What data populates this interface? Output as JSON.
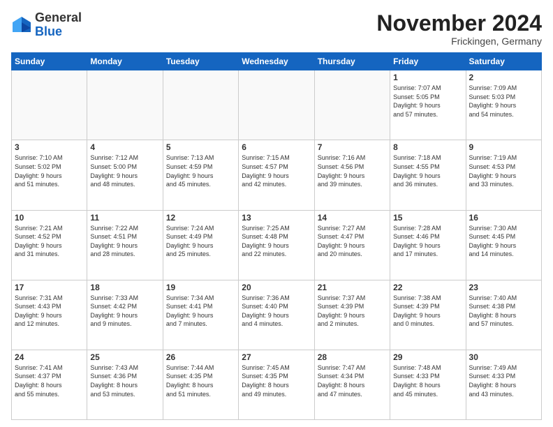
{
  "logo": {
    "general": "General",
    "blue": "Blue"
  },
  "header": {
    "month": "November 2024",
    "location": "Frickingen, Germany"
  },
  "weekdays": [
    "Sunday",
    "Monday",
    "Tuesday",
    "Wednesday",
    "Thursday",
    "Friday",
    "Saturday"
  ],
  "weeks": [
    [
      {
        "day": "",
        "info": ""
      },
      {
        "day": "",
        "info": ""
      },
      {
        "day": "",
        "info": ""
      },
      {
        "day": "",
        "info": ""
      },
      {
        "day": "",
        "info": ""
      },
      {
        "day": "1",
        "info": "Sunrise: 7:07 AM\nSunset: 5:05 PM\nDaylight: 9 hours\nand 57 minutes."
      },
      {
        "day": "2",
        "info": "Sunrise: 7:09 AM\nSunset: 5:03 PM\nDaylight: 9 hours\nand 54 minutes."
      }
    ],
    [
      {
        "day": "3",
        "info": "Sunrise: 7:10 AM\nSunset: 5:02 PM\nDaylight: 9 hours\nand 51 minutes."
      },
      {
        "day": "4",
        "info": "Sunrise: 7:12 AM\nSunset: 5:00 PM\nDaylight: 9 hours\nand 48 minutes."
      },
      {
        "day": "5",
        "info": "Sunrise: 7:13 AM\nSunset: 4:59 PM\nDaylight: 9 hours\nand 45 minutes."
      },
      {
        "day": "6",
        "info": "Sunrise: 7:15 AM\nSunset: 4:57 PM\nDaylight: 9 hours\nand 42 minutes."
      },
      {
        "day": "7",
        "info": "Sunrise: 7:16 AM\nSunset: 4:56 PM\nDaylight: 9 hours\nand 39 minutes."
      },
      {
        "day": "8",
        "info": "Sunrise: 7:18 AM\nSunset: 4:55 PM\nDaylight: 9 hours\nand 36 minutes."
      },
      {
        "day": "9",
        "info": "Sunrise: 7:19 AM\nSunset: 4:53 PM\nDaylight: 9 hours\nand 33 minutes."
      }
    ],
    [
      {
        "day": "10",
        "info": "Sunrise: 7:21 AM\nSunset: 4:52 PM\nDaylight: 9 hours\nand 31 minutes."
      },
      {
        "day": "11",
        "info": "Sunrise: 7:22 AM\nSunset: 4:51 PM\nDaylight: 9 hours\nand 28 minutes."
      },
      {
        "day": "12",
        "info": "Sunrise: 7:24 AM\nSunset: 4:49 PM\nDaylight: 9 hours\nand 25 minutes."
      },
      {
        "day": "13",
        "info": "Sunrise: 7:25 AM\nSunset: 4:48 PM\nDaylight: 9 hours\nand 22 minutes."
      },
      {
        "day": "14",
        "info": "Sunrise: 7:27 AM\nSunset: 4:47 PM\nDaylight: 9 hours\nand 20 minutes."
      },
      {
        "day": "15",
        "info": "Sunrise: 7:28 AM\nSunset: 4:46 PM\nDaylight: 9 hours\nand 17 minutes."
      },
      {
        "day": "16",
        "info": "Sunrise: 7:30 AM\nSunset: 4:45 PM\nDaylight: 9 hours\nand 14 minutes."
      }
    ],
    [
      {
        "day": "17",
        "info": "Sunrise: 7:31 AM\nSunset: 4:43 PM\nDaylight: 9 hours\nand 12 minutes."
      },
      {
        "day": "18",
        "info": "Sunrise: 7:33 AM\nSunset: 4:42 PM\nDaylight: 9 hours\nand 9 minutes."
      },
      {
        "day": "19",
        "info": "Sunrise: 7:34 AM\nSunset: 4:41 PM\nDaylight: 9 hours\nand 7 minutes."
      },
      {
        "day": "20",
        "info": "Sunrise: 7:36 AM\nSunset: 4:40 PM\nDaylight: 9 hours\nand 4 minutes."
      },
      {
        "day": "21",
        "info": "Sunrise: 7:37 AM\nSunset: 4:39 PM\nDaylight: 9 hours\nand 2 minutes."
      },
      {
        "day": "22",
        "info": "Sunrise: 7:38 AM\nSunset: 4:39 PM\nDaylight: 9 hours\nand 0 minutes."
      },
      {
        "day": "23",
        "info": "Sunrise: 7:40 AM\nSunset: 4:38 PM\nDaylight: 8 hours\nand 57 minutes."
      }
    ],
    [
      {
        "day": "24",
        "info": "Sunrise: 7:41 AM\nSunset: 4:37 PM\nDaylight: 8 hours\nand 55 minutes."
      },
      {
        "day": "25",
        "info": "Sunrise: 7:43 AM\nSunset: 4:36 PM\nDaylight: 8 hours\nand 53 minutes."
      },
      {
        "day": "26",
        "info": "Sunrise: 7:44 AM\nSunset: 4:35 PM\nDaylight: 8 hours\nand 51 minutes."
      },
      {
        "day": "27",
        "info": "Sunrise: 7:45 AM\nSunset: 4:35 PM\nDaylight: 8 hours\nand 49 minutes."
      },
      {
        "day": "28",
        "info": "Sunrise: 7:47 AM\nSunset: 4:34 PM\nDaylight: 8 hours\nand 47 minutes."
      },
      {
        "day": "29",
        "info": "Sunrise: 7:48 AM\nSunset: 4:33 PM\nDaylight: 8 hours\nand 45 minutes."
      },
      {
        "day": "30",
        "info": "Sunrise: 7:49 AM\nSunset: 4:33 PM\nDaylight: 8 hours\nand 43 minutes."
      }
    ]
  ]
}
